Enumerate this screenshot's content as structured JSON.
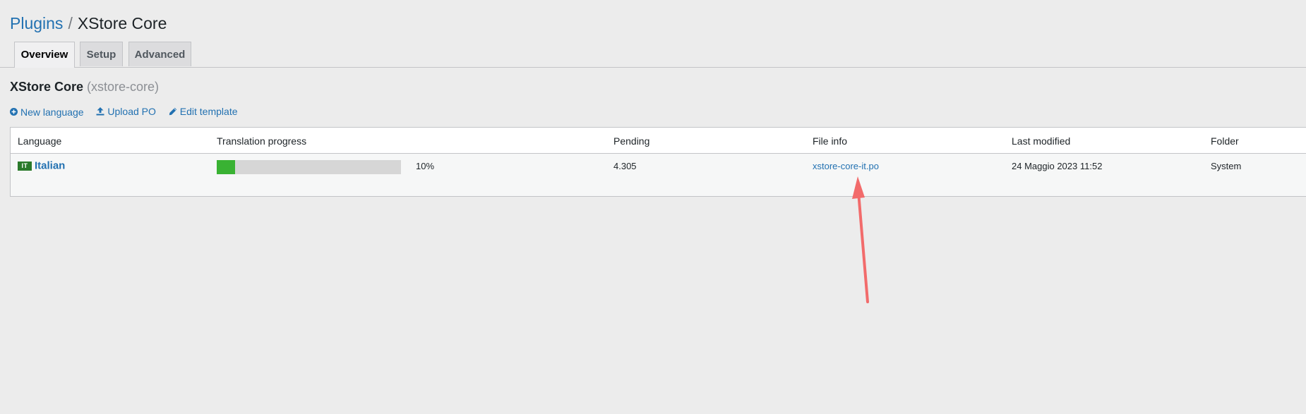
{
  "breadcrumb": {
    "parent": "Plugins",
    "separator": "/",
    "current": "XStore Core"
  },
  "tabs": [
    {
      "label": "Overview",
      "active": true
    },
    {
      "label": "Setup",
      "active": false
    },
    {
      "label": "Advanced",
      "active": false
    }
  ],
  "section": {
    "title": "XStore Core",
    "slug": "(xstore-core)"
  },
  "actions": [
    {
      "label": "New language",
      "icon": "plus-circle-icon"
    },
    {
      "label": "Upload PO",
      "icon": "upload-icon"
    },
    {
      "label": "Edit template",
      "icon": "pencil-icon"
    }
  ],
  "table": {
    "headers": [
      "Language",
      "Translation progress",
      "Pending",
      "File info",
      "Last modified",
      "Folder"
    ],
    "rows": [
      {
        "flag": "IT",
        "language": "Italian",
        "progress_percent": 10,
        "progress_label": "10%",
        "pending": "4.305",
        "file": "xstore-core-it.po",
        "modified": "24 Maggio 2023 11:52",
        "folder": "System"
      }
    ]
  },
  "colors": {
    "link": "#2271b1",
    "progress_fill": "#39b233",
    "flag_bg": "#2b7a2b",
    "annotation_arrow": "#f26b6b"
  }
}
